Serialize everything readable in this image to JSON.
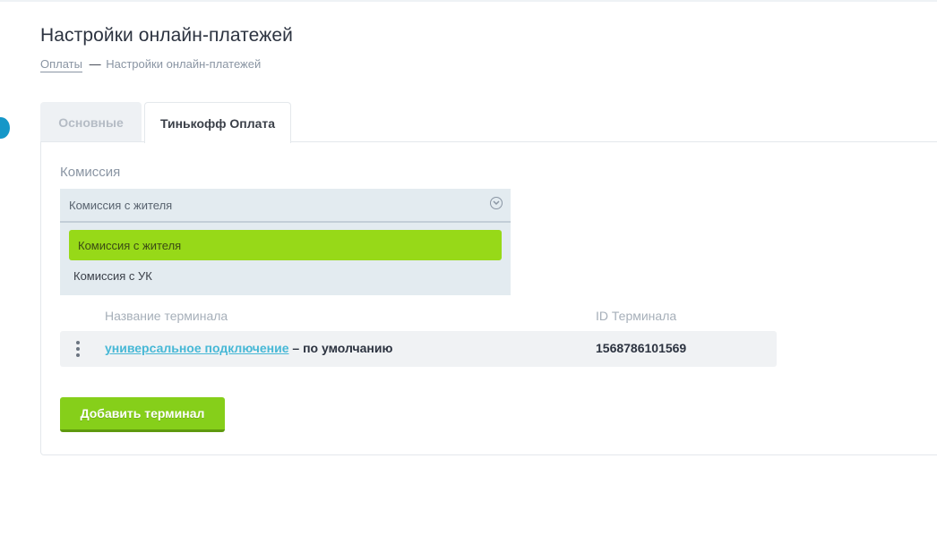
{
  "page": {
    "title": "Настройки онлайн-платежей",
    "breadcrumb": {
      "link": "Оплаты",
      "separator": "—",
      "current": "Настройки онлайн-платежей"
    }
  },
  "tabs": [
    {
      "label": "Основные",
      "active": false
    },
    {
      "label": "Тинькофф Оплата",
      "active": true
    }
  ],
  "commission": {
    "label": "Комиссия",
    "selected_value": "Комиссия с жителя",
    "options": [
      "Комиссия с жителя",
      "Комиссия с УК"
    ]
  },
  "terminals": {
    "columns": [
      "Название терминала",
      "ID Терминала"
    ],
    "rows": [
      {
        "name_link": "универсальное подключение",
        "name_suffix": " – по умолчанию",
        "id": "1568786101569"
      }
    ]
  },
  "add_button_label": "Добавить терминал",
  "colors": {
    "accent_green": "#97d918",
    "button_green": "#86cf1a",
    "link_blue": "#47b8d6",
    "side_toggle_blue": "#1597c8"
  }
}
